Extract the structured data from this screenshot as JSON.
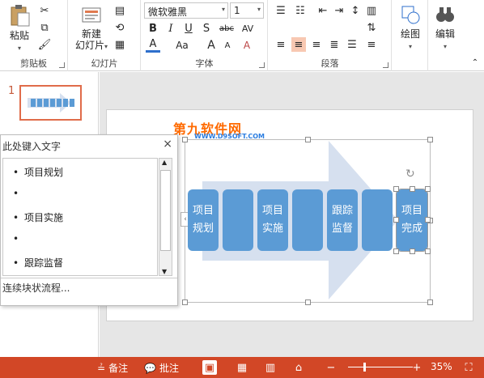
{
  "ribbon": {
    "clipboard": {
      "label": "剪贴板",
      "paste": "粘贴"
    },
    "slides": {
      "label": "幻灯片",
      "new_slide_line1": "新建",
      "new_slide_line2": "幻灯片"
    },
    "font": {
      "label": "字体",
      "font_name": "微软雅黑",
      "font_size": "1",
      "bold": "B",
      "italic": "I",
      "underline": "U",
      "strike": "S",
      "abc": "abc",
      "av": "AV",
      "aa": "Aa",
      "grow": "A",
      "shrink": "A",
      "clear": "A",
      "color_a": "A"
    },
    "paragraph": {
      "label": "段落"
    },
    "drawing": {
      "label": "绘图"
    },
    "editing": {
      "label": "编辑"
    }
  },
  "thumbnail": {
    "number": "1"
  },
  "text_pane": {
    "title": "此处键入文字",
    "close": "×",
    "items": [
      "项目规划",
      "",
      "项目实施",
      "",
      "跟踪监督"
    ],
    "footer": "连续块状流程..."
  },
  "smartart": {
    "boxes": [
      {
        "text_line1": "项目",
        "text_line2": "规划"
      },
      {
        "text_line1": "",
        "text_line2": ""
      },
      {
        "text_line1": "项目",
        "text_line2": "实施"
      },
      {
        "text_line1": "",
        "text_line2": ""
      },
      {
        "text_line1": "跟踪",
        "text_line2": "监督"
      },
      {
        "text_line1": "",
        "text_line2": ""
      },
      {
        "text_line1": "项目",
        "text_line2": "完成"
      }
    ]
  },
  "watermark": {
    "main": "第九软件网",
    "sub": "WWW.D9SOFT.COM"
  },
  "status_bar": {
    "notes": "备注",
    "comments": "批注",
    "zoom": "35%"
  },
  "colors": {
    "accent": "#d24726",
    "smartart_box": "#5b9bd5",
    "arrow": "#d6e0ef"
  }
}
